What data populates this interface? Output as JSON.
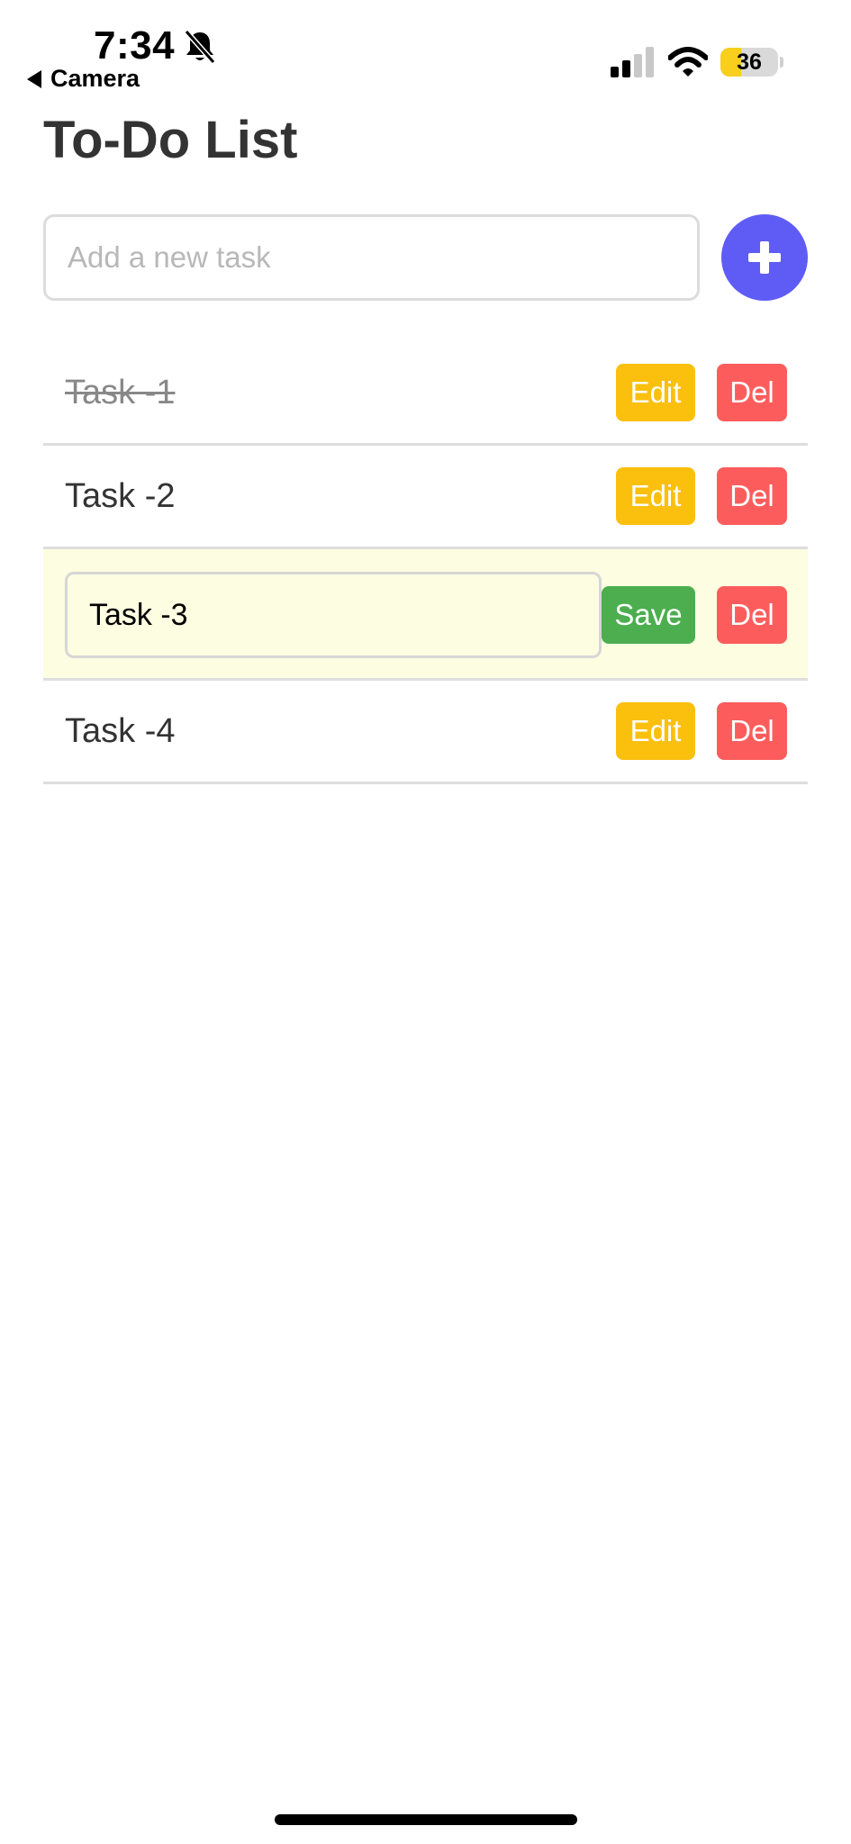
{
  "status_bar": {
    "time": "7:34",
    "back_app_label": "Camera",
    "battery_level": "36",
    "battery_fraction": 0.36,
    "battery_color": "#f7cf1c",
    "icons": [
      "bell-slash-icon",
      "cellular-signal-icon",
      "wifi-icon",
      "battery-icon"
    ]
  },
  "header": {
    "title": "To-Do List"
  },
  "add_task": {
    "placeholder": "Add a new task",
    "value": "",
    "button_icon": "plus-icon",
    "button_color": "#5f5cf6"
  },
  "tasks": [
    {
      "text": "Task -1",
      "completed": true,
      "editing": false,
      "edit_label": "Edit",
      "delete_label": "Del"
    },
    {
      "text": "Task -2",
      "completed": false,
      "editing": false,
      "edit_label": "Edit",
      "delete_label": "Del"
    },
    {
      "text": "Task -3",
      "completed": false,
      "editing": true,
      "save_label": "Save",
      "delete_label": "Del"
    },
    {
      "text": "Task -4",
      "completed": false,
      "editing": false,
      "edit_label": "Edit",
      "delete_label": "Del"
    }
  ],
  "colors": {
    "edit_button": "#fbbf0e",
    "save_button": "#4cae4f",
    "delete_button": "#fc5d5c",
    "editing_row_bg": "#fdfde1"
  }
}
